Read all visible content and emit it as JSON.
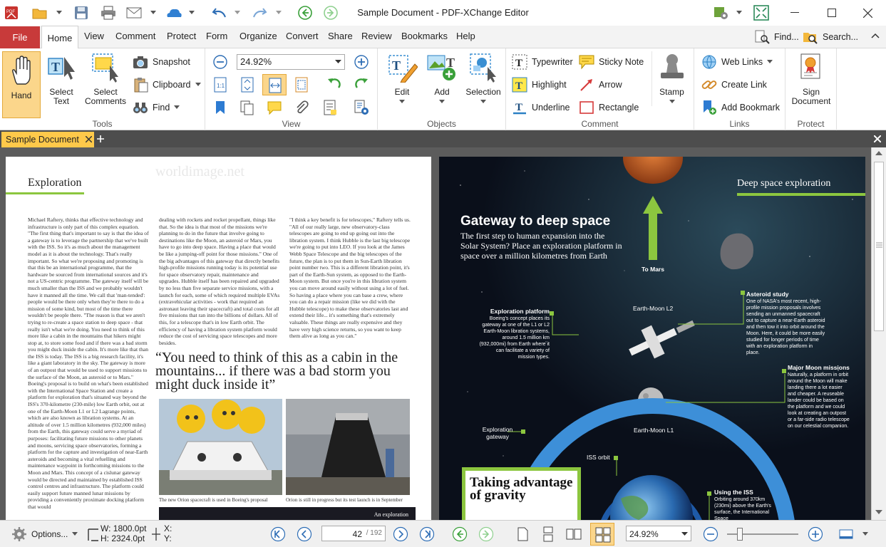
{
  "window": {
    "title": "Sample Document - PDF-XChange Editor"
  },
  "menu": {
    "file": "File",
    "tabs": [
      "Home",
      "View",
      "Comment",
      "Protect",
      "Form",
      "Organize",
      "Convert",
      "Share",
      "Review",
      "Bookmarks",
      "Help"
    ],
    "find": "Find...",
    "search": "Search..."
  },
  "ribbon": {
    "tools": {
      "label": "Tools",
      "hand": "Hand",
      "select_text": "Select Text",
      "select_comments": "Select Comments",
      "snapshot": "Snapshot",
      "clipboard": "Clipboard",
      "find": "Find"
    },
    "view": {
      "label": "View",
      "zoom": "24.92%"
    },
    "objects": {
      "label": "Objects",
      "edit": "Edit",
      "add": "Add",
      "selection": "Selection"
    },
    "comment": {
      "label": "Comment",
      "typewriter": "Typewriter",
      "sticky_note": "Sticky Note",
      "highlight": "Highlight",
      "arrow": "Arrow",
      "underline": "Underline",
      "rectangle": "Rectangle",
      "stamp": "Stamp"
    },
    "links": {
      "label": "Links",
      "web_links": "Web Links",
      "create_link": "Create Link",
      "add_bookmark": "Add Bookmark"
    },
    "protect": {
      "label": "Protect",
      "sign_document": "Sign Document"
    }
  },
  "doc_tab": {
    "name": "Sample Document"
  },
  "left_page": {
    "heading": "Exploration",
    "watermark": "worldimage.net",
    "col1": "Michael Raftery, thinks that effective technology and infrastructure is only part of this complex equation. \"The first thing that's important to say is that the idea of a gateway is to leverage the partnership that we've built with the ISS. So it's as much about the management model as it is about the technology. That's really important. So what we're proposing and promoting is that this be an international programme, that the hardware be sourced from international sources and it's not a US-centric programme. The gateway itself will be much smaller than the ISS and we probably wouldn't have it manned all the time. We call that 'man-tended': people would be there only when they're there to do a mission of some kind, but most of the time there wouldn't be people there. \"The reason is that we aren't trying to re-create a space station to deep space - that really isn't what we're doing. You need to think of this more like a cabin in the mountains that hikers might stop at, to store some food and if there was a bad storm you might duck inside the cabin. It's more like that than the ISS is today. The ISS is a big research facility, it's like a giant laboratory in the sky. The gateway is more of an outpost that would be used to support missions to the surface of the Moon, an asteroid or to Mars.\" Boeing's proposal is to build on what's been established with the International Space Station and create a platform for exploration that's situated way beyond the ISS's 370-kilometre (230-mile) low Earth orbit, out at one of the Earth-Moon L1 or L2 Lagrange points, which are also known as libration systems. At an altitude of over 1.5 million kilometres (932,000 miles) from the Earth, this gateway could serve a myriad of purposes: facilitating future missions to other planets and moons, servicing space observatories, forming a platform for the capture and investigation of near-Earth asteroids and becoming a vital refuelling and maintenance waypoint in forthcoming missions to the Moon and Mars. This concept of a cislunar gateway would be directed and maintained by established ISS control centres and infrastructure. The platform could easily support future manned lunar missions by providing a conveniently proximate docking platform that would",
    "col2": "dealing with rockets and rocket propellant, things like that. So the idea is that most of the missions we're planning to do in the future that involve going to destinations like the Moon, an asteroid or Mars, you have to go into deep space. Having a place that would be like a jumping-off point for those missions.\" One of the big advantages of this gateway that directly benefits high-profile missions running today is its potential use for space observatory repair, maintenance and upgrades. Hubble itself has been repaired and upgraded by no less than five separate service missions, with a launch for each, some of which required multiple EVAs (extravehicular activities - work that required an astronaut leaving their spacecraft) and total costs for all five missions that ran into the billions of dollars. All of this, for a telescope that's in low Earth orbit. The efficiency of having a libration system platform would reduce the cost of servicing space telescopes and more besides.",
    "col3": "\"I think a key benefit is for telescopes,\" Raftery tells us. \"All of our really large, new observatory-class telescopes are going to end up going out into the libration system. I think Hubble is the last big telescope we're going to put into LEO. If you look at the James Webb Space Telescope and the big telescopes of the future, the plan is to put them in Sun-Earth libration point number two. This is a different libration point, it's part of the Earth-Sun system, as opposed to the Earth-Moon system. But once you're in this libration system you can move around easily without using a lot of fuel. So having a place where you can base a crew, where you can do a repair mission (like we did with the Hubble telescope) to make these observatories last and extend their life... it's something that's extremely valuable. These things are really expensive and they have very high science returns, so you want to keep them alive as long as you can.\"",
    "quote": "“You need to think of this as a cabin in the mountains... if there was a bad storm you might duck inside it”",
    "caption1": "The new Orion spacecraft is used in Boeing's proposal",
    "caption2": "Orion is still in progress but its test launch is in September",
    "banner": "An exploration"
  },
  "right_page": {
    "section": "Deep space exploration",
    "title": "Gateway to deep space",
    "subtitle": "The first step to human expansion into the Solar System? Place an exploration platform in space over a million kilometres from Earth",
    "to_mars": "To Mars",
    "asteroid_title": "Asteroid study",
    "asteroid_text": "One of NASA's most recent, high-profile mission proposals involves sending an unmanned spacecraft out to capture a near-Earth asteroid and then tow it into orbit around the Moon. Here, it could be more easily studied for longer periods of time with an exploration platform in place.",
    "earth_moon_l2": "Earth-Moon L2",
    "platform_title": "Exploration platform",
    "platform_text": "Boeing's concept places its gateway at one of the L1 or L2 Earth-Moon libration systems, around 1.5 million km (932,000mi) from Earth where it can facilitate a variety of mission types.",
    "moon_title": "Major Moon missions",
    "moon_text": "Naturally, a platform in orbit around the Moon will make landing there a lot easier and cheaper. A reuseable lander could be based on the platform and we could look at creating an outpost or a far-side radio telescope on our celestial companion.",
    "gateway_label": "Exploration gateway",
    "earth_moon_l1": "Earth-Moon L1",
    "iss_orbit": "ISS orbit",
    "using_iss_title": "Using the ISS",
    "using_iss_text": "Orbiting around 370km (230mi) above the Earth's surface, the International Space",
    "gravity_box": "Taking advantage of gravity"
  },
  "status": {
    "options": "Options...",
    "width": "W: 1800.0pt",
    "height": "H: 2324.0pt",
    "x": "X:",
    "y": "Y:",
    "page": "42",
    "pages": "/ 192",
    "zoom": "24.92%"
  },
  "colors": {
    "accent": "#ffc94a",
    "file_tab": "#c83a3a",
    "dark_bg": "#5c5c5c",
    "diagram_green": "#8cc63f",
    "orbit_blue": "#3d8fd8"
  }
}
